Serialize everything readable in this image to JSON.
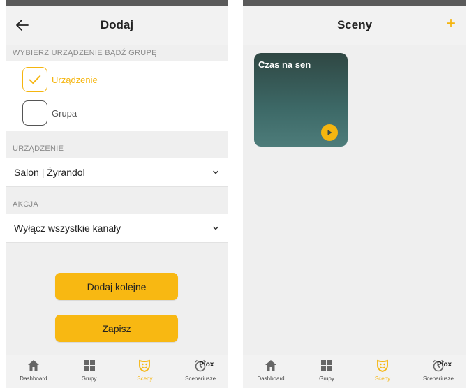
{
  "left": {
    "title": "Dodaj",
    "choose_label": "WYBIERZ URZĄDZENIE BĄDŹ GRUPĘ",
    "options": [
      {
        "label": "Urządzenie",
        "checked": true
      },
      {
        "label": "Grupa",
        "checked": false
      }
    ],
    "device_label": "URZĄDZENIE",
    "device_value": "Salon | Żyrandol",
    "action_label": "AKCJA",
    "action_value": "Wyłącz wszystkie kanały",
    "add_more_button": "Dodaj kolejne",
    "save_button": "Zapisz"
  },
  "right": {
    "title": "Sceny",
    "scenes": [
      {
        "name": "Czas na sen"
      }
    ]
  },
  "tabs": [
    {
      "label": "Dashboard",
      "icon": "home-icon",
      "active": false
    },
    {
      "label": "Grupy",
      "icon": "grid-icon",
      "active": false
    },
    {
      "label": "Sceny",
      "icon": "theater-mask-icon",
      "active": true
    },
    {
      "label": "Scenariusze",
      "icon": "alarm-clock-icon",
      "active": false
    }
  ],
  "plox_text": "Plox",
  "colors": {
    "accent": "#f5b50f",
    "button": "#f8b812",
    "scene_card": "#3d6967"
  }
}
